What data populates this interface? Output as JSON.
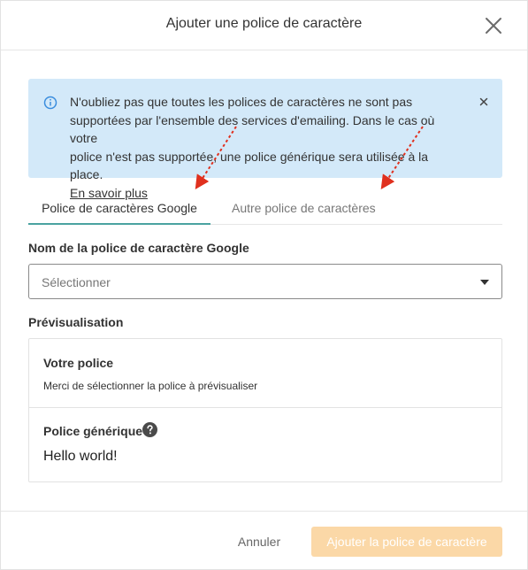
{
  "dialog": {
    "title": "Ajouter une police de caractère"
  },
  "info": {
    "line1": "N'oubliez pas que toutes les polices de caractères ne sont pas",
    "line2": "supportées par l'ensemble des services d'emailing. Dans le cas où votre",
    "line3": "police n'est pas supportée, une police générique sera utilisée à la place.",
    "link": "En savoir plus"
  },
  "tabs": [
    {
      "label": "Police de caractères Google",
      "active": true
    },
    {
      "label": "Autre police de caractères",
      "active": false
    }
  ],
  "form": {
    "font_label": "Nom de la police de caractère Google",
    "select_value": "Sélectionner"
  },
  "preview": {
    "label": "Prévisualisation",
    "your_font_title": "Votre police",
    "your_font_message": "Merci de sélectionner la police à prévisualiser",
    "generic_title": "Police générique",
    "sample_text": "Hello world!"
  },
  "footer": {
    "cancel_label": "Annuler",
    "submit_label": "Ajouter la police de caractère"
  },
  "colors": {
    "info_background": "#d3e9f9",
    "info_icon": "#3a8dde",
    "tab_active_underline": "#4aa3a1",
    "annotation_arrow": "#e0301e",
    "submit_disabled": "#fbd8a7"
  },
  "icons": {
    "close": "close-icon",
    "info": "info-icon",
    "info_close": "close-icon",
    "select_caret": "caret-down-icon",
    "help": "help-icon"
  }
}
